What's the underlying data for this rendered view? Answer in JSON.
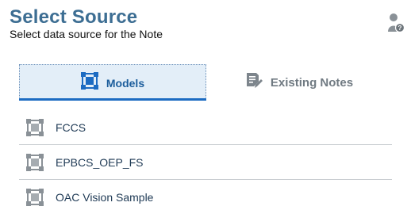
{
  "header": {
    "title": "Select Source",
    "subtitle": "Select data source for the Note",
    "help_icon": "user-help-icon"
  },
  "tabs": [
    {
      "label": "Models",
      "icon": "model-cube-icon",
      "selected": true,
      "accent": "#1c6bc2"
    },
    {
      "label": "Existing Notes",
      "icon": "note-edit-icon",
      "selected": false
    }
  ],
  "models": [
    {
      "label": "FCCS",
      "icon": "model-cube-icon"
    },
    {
      "label": "EPBCS_OEP_FS",
      "icon": "model-cube-icon"
    },
    {
      "label": "OAC Vision Sample",
      "icon": "model-cube-icon"
    }
  ]
}
